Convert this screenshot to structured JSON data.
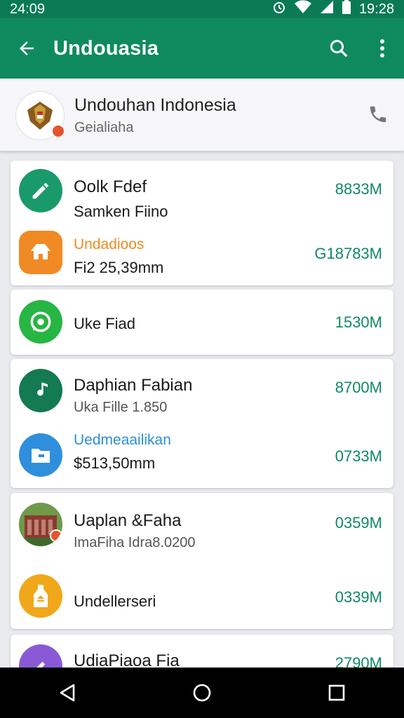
{
  "status_bar": {
    "time_left": "24:09",
    "time_right": "19:28"
  },
  "app_bar": {
    "title": "Undouasia"
  },
  "contact": {
    "name": "Undouhan Indonesia",
    "subtitle": "Geialiaha"
  },
  "cards": [
    {
      "rows": [
        {
          "line1": "Oolk Fdef",
          "line2": "Samken Fiino",
          "size": "8833M",
          "icon": "pen-icon",
          "color": "#1a9a6a"
        },
        {
          "line1": "Undadioos",
          "line2": "Fi2 25,39mm",
          "size": "G18783M",
          "icon": "shirt-icon",
          "color": "#f08a25",
          "line1_style": "orange"
        }
      ]
    },
    {
      "rows": [
        {
          "line1": "Uke Fiad",
          "size": "1530M",
          "icon": "whatsapp-icon",
          "color": "#27b543"
        }
      ]
    },
    {
      "rows": [
        {
          "line1": "Daphian Fabian",
          "line2": "Uka Fille 1.850",
          "size": "8700M",
          "icon": "music-note-icon",
          "color": "#137a52",
          "line2_style": "gray"
        },
        {
          "line1": "Uedmeaailikan",
          "line2": "$513,50mm",
          "size": "0733M",
          "icon": "folder-icon",
          "color": "#2f8fdc",
          "line1_style": "blue"
        }
      ]
    },
    {
      "rows": [
        {
          "line1": "Uaplan &Faha",
          "line2": "ImaFiha Idra8.0200",
          "size": "0359M",
          "icon": "building-photo-icon",
          "color": "#5a8a3a",
          "line2_style": "gray"
        },
        {
          "line1": "Undellerseri",
          "size": "0339M",
          "icon": "bottle-icon",
          "color": "#f0a81a"
        }
      ]
    },
    {
      "rows": [
        {
          "line1": "UdiaPiaoa Fia",
          "size": "2790M",
          "icon": "edit-icon",
          "color": "#8a5ad6"
        }
      ]
    }
  ]
}
